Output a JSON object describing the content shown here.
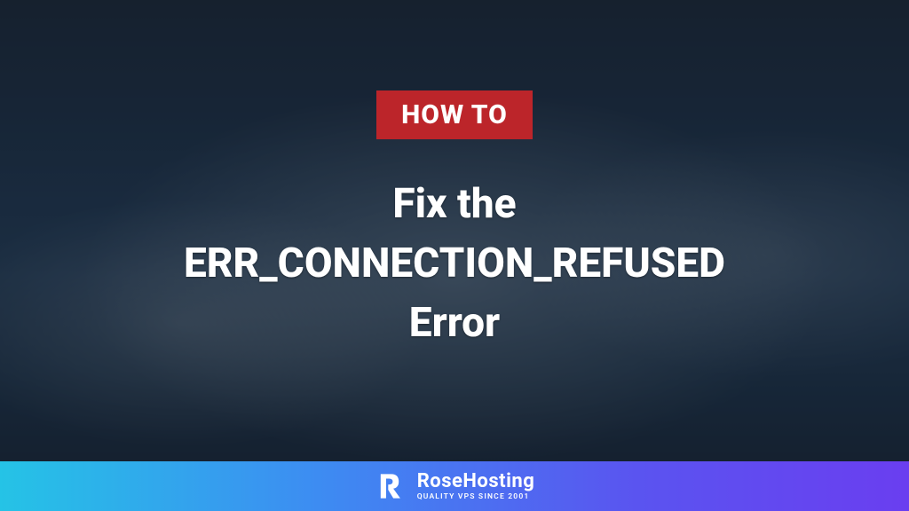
{
  "badge": {
    "label": "HOW TO"
  },
  "title": {
    "line1": "Fix the",
    "line2": "ERR_CONNECTION_REFUSED",
    "line3": "Error"
  },
  "brand": {
    "name": "RoseHosting",
    "tagline": "QUALITY VPS SINCE 2001"
  },
  "colors": {
    "badge_bg": "#c92127",
    "footer_gradient_start": "#25c3e6",
    "footer_gradient_end": "#6a3ef0"
  }
}
